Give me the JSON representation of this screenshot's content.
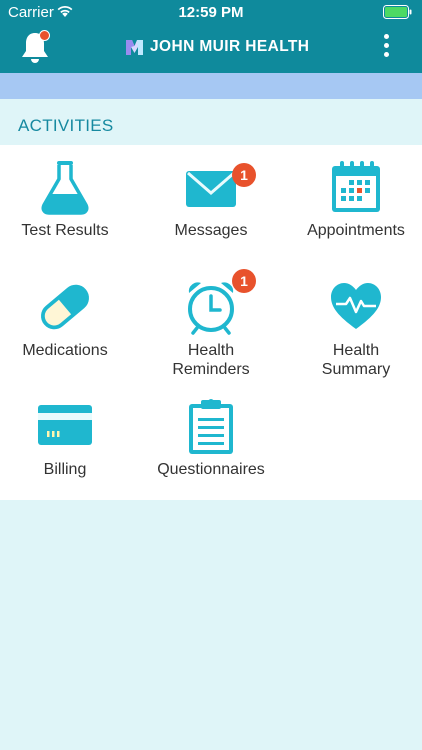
{
  "status_bar": {
    "carrier": "Carrier",
    "time": "12:59 PM"
  },
  "header": {
    "brand": "JOHN MUIR HEALTH",
    "notification_dot_color": "#e8522c",
    "background_color": "#0f8a9c"
  },
  "activities": {
    "title": "ACTIVITIES",
    "tiles": [
      {
        "label": "Test Results",
        "icon": "flask-icon"
      },
      {
        "label": "Messages",
        "icon": "envelope-icon",
        "badge": "1"
      },
      {
        "label": "Appointments",
        "icon": "calendar-icon"
      },
      {
        "label": "Medications",
        "icon": "pill-capsule-icon"
      },
      {
        "label_line1": "Health",
        "label_line2": "Reminders",
        "icon": "alarm-clock-icon",
        "badge": "1"
      },
      {
        "label_line1": "Health",
        "label_line2": "Summary",
        "icon": "heart-pulse-icon"
      },
      {
        "label": "Billing",
        "icon": "credit-card-icon"
      },
      {
        "label": "Questionnaires",
        "icon": "clipboard-icon"
      }
    ]
  },
  "colors": {
    "accent": "#1fb7cf",
    "badge": "#e8522c",
    "banner": "#a6c8f3",
    "page_background": "#dff5f8"
  }
}
